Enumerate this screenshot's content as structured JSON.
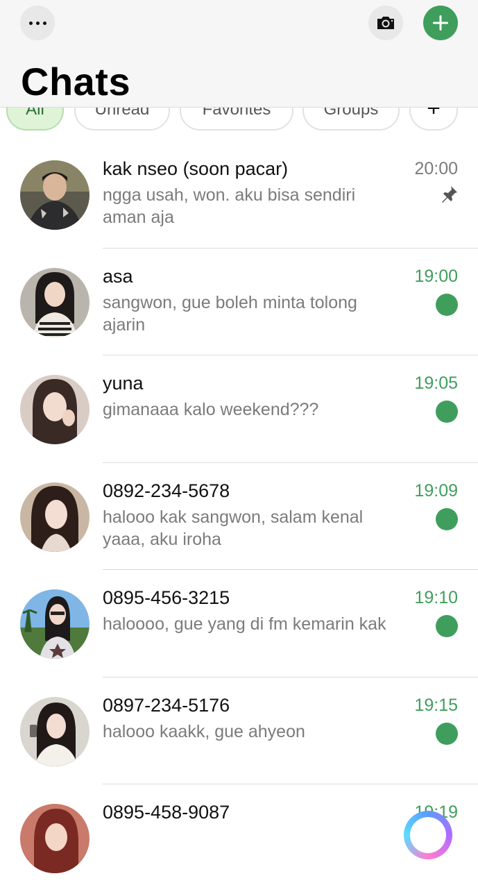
{
  "header": {
    "title": "Chats",
    "more_icon": "ellipsis-icon",
    "camera_icon": "camera-icon",
    "add_icon": "plus-icon",
    "accent_color": "#3f9e5c"
  },
  "filters": [
    {
      "label": "All",
      "active": true
    },
    {
      "label": "Unread",
      "active": false
    },
    {
      "label": "Favorites",
      "active": false
    },
    {
      "label": "Groups",
      "active": false
    },
    {
      "label": "+",
      "active": false
    }
  ],
  "chats": [
    {
      "name": "kak nseo (soon pacar)",
      "preview": "ngga usah, won. aku bisa sendiri aman aja",
      "time": "20:00",
      "unread": false,
      "pinned": true
    },
    {
      "name": "asa",
      "preview": "sangwon, gue boleh minta tolong ajarin",
      "time": "19:00",
      "unread": true,
      "pinned": false
    },
    {
      "name": "yuna",
      "preview": "gimanaaa kalo weekend???",
      "time": "19:05",
      "unread": true,
      "pinned": false
    },
    {
      "name": "0892-234-5678",
      "preview": "halooo kak sangwon, salam kenal yaaa, aku iroha",
      "time": "19:09",
      "unread": true,
      "pinned": false
    },
    {
      "name": "0895-456-3215",
      "preview": "haloooo, gue yang di fm kemarin kak",
      "time": "19:10",
      "unread": true,
      "pinned": false
    },
    {
      "name": "0897-234-5176",
      "preview": "halooo kaakk, gue ahyeon",
      "time": "19:15",
      "unread": true,
      "pinned": false
    },
    {
      "name": "0895-458-9087",
      "preview": "",
      "time": "19:19",
      "unread": true,
      "pinned": false
    }
  ],
  "colors": {
    "unread_green": "#3f9e5c",
    "muted_gray": "#7b7b7b",
    "active_chip_bg": "#dff4d7"
  }
}
